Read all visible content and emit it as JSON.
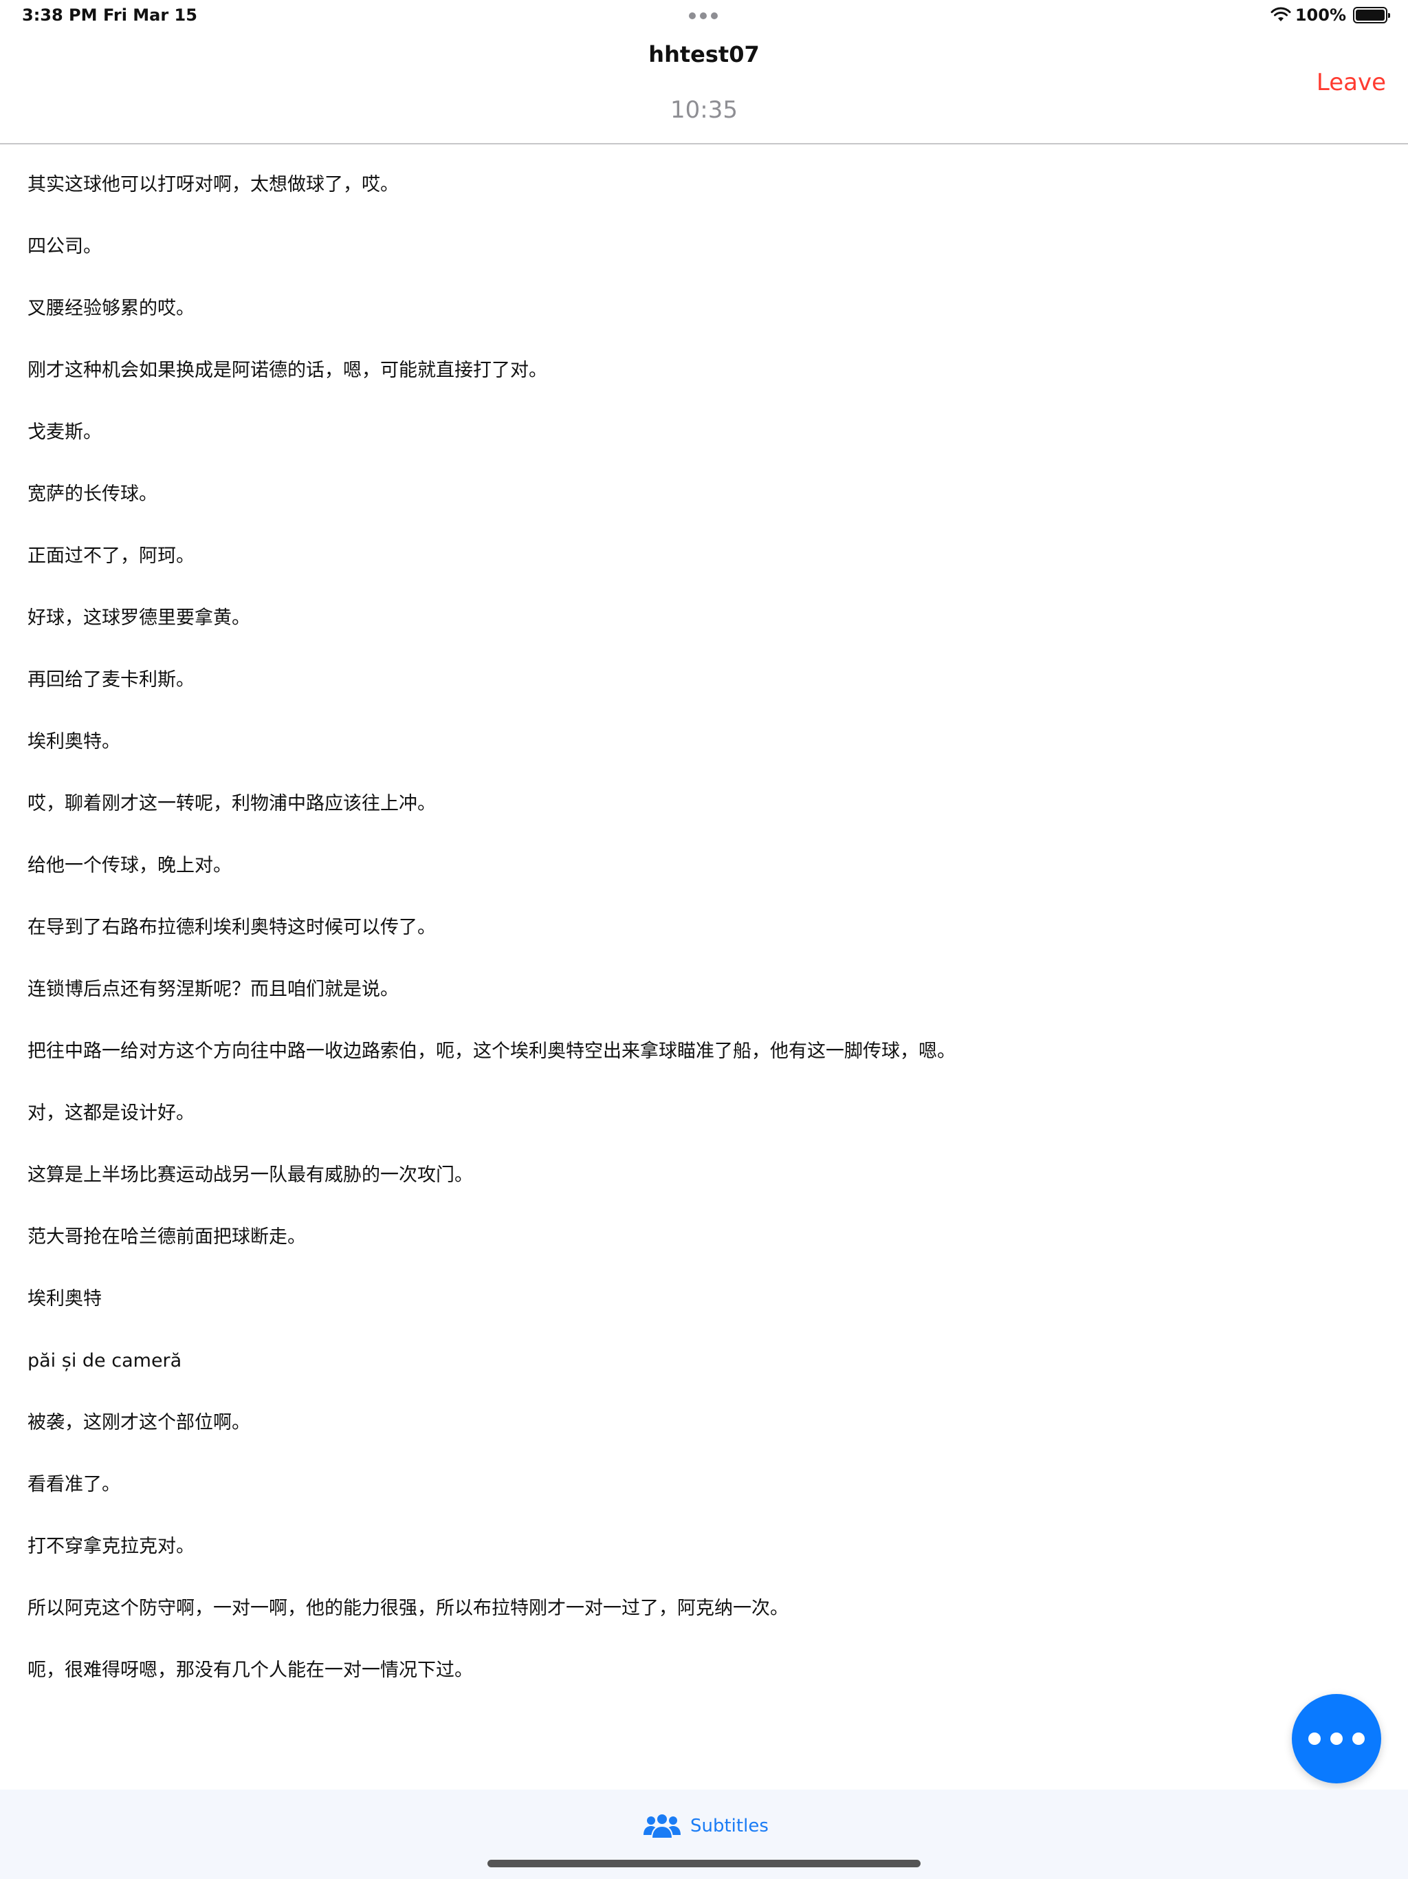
{
  "status_bar": {
    "time": "3:38 PM",
    "date": "Fri Mar 15",
    "battery": "100%"
  },
  "header": {
    "title": "hhtest07",
    "timer": "10:35",
    "leave_label": "Leave"
  },
  "subtitles": [
    "其实这球他可以打呀对啊，太想做球了，哎。",
    "四公司。",
    "叉腰经验够累的哎。",
    "刚才这种机会如果换成是阿诺德的话，嗯，可能就直接打了对。",
    "戈麦斯。",
    "宽萨的长传球。",
    "正面过不了，阿珂。",
    "好球，这球罗德里要拿黄。",
    "再回给了麦卡利斯。",
    "埃利奥特。",
    "哎，聊着刚才这一转呢，利物浦中路应该往上冲。",
    "给他一个传球，晚上对。",
    "在导到了右路布拉德利埃利奥特这时候可以传了。",
    "连锁博后点还有努涅斯呢？而且咱们就是说。",
    "把往中路一给对方这个方向往中路一收边路索伯，呃，这个埃利奥特空出来拿球瞄准了船，他有这一脚传球，嗯。",
    "对，这都是设计好。",
    "这算是上半场比赛运动战另一队最有威胁的一次攻门。",
    "范大哥抢在哈兰德前面把球断走。",
    "埃利奥特",
    "păi și de cameră",
    "被袭，这刚才这个部位啊。",
    "看看准了。",
    "打不穿拿克拉克对。",
    "所以阿克这个防守啊，一对一啊，他的能力很强，所以布拉特刚才一对一过了，阿克纳一次。",
    "呃，很难得呀嗯，那没有几个人能在一对一情况下过。"
  ],
  "tab_bar": {
    "subtitles_label": "Subtitles"
  },
  "colors": {
    "leave": "#ff3b30",
    "fab": "#0a7aff",
    "tab_active": "#1a7cf5",
    "timer": "#8e8e93"
  },
  "icons": {
    "fab": "more-dots-icon",
    "tab": "people-icon",
    "wifi": "wifi-icon",
    "battery": "battery-icon"
  }
}
